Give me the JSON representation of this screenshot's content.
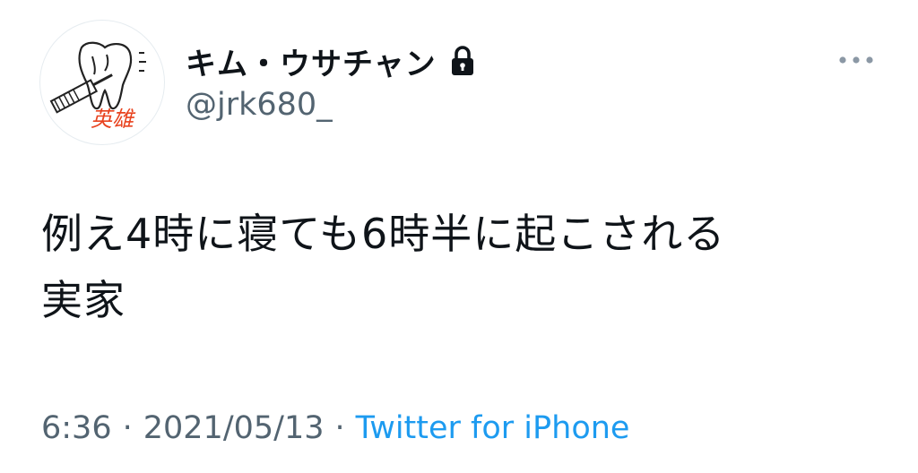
{
  "user": {
    "display_name": "キム・ウサチャン",
    "handle": "@jrk680_",
    "protected_icon": "lock-icon",
    "avatar_text": "英雄"
  },
  "tweet": {
    "text_lines": [
      "例え4時に寝ても6時半に起こされる",
      "実家"
    ]
  },
  "meta": {
    "time": "6:36",
    "separator": "·",
    "date": "2021/05/13",
    "source": "Twitter for iPhone"
  },
  "more_icon": "ellipsis-icon",
  "colors": {
    "text_primary": "#0f1419",
    "text_secondary": "#536471",
    "link": "#1d9bf0",
    "avatar_stamp": "#e8431f"
  }
}
